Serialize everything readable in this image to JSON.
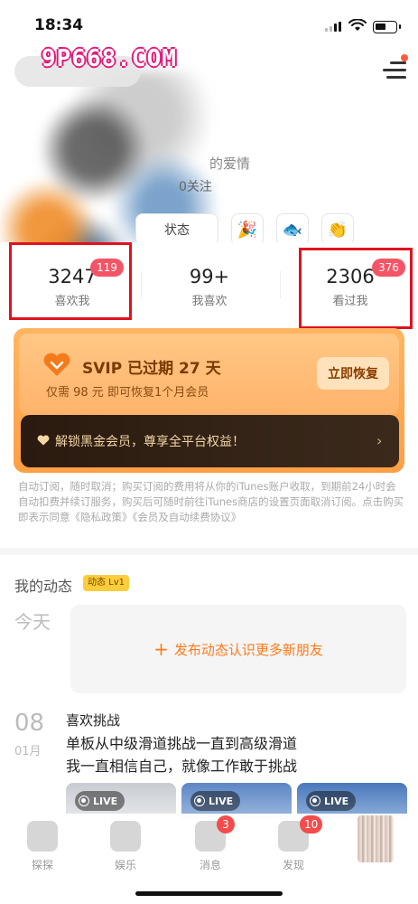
{
  "status_bar": {
    "time": "18:34"
  },
  "header": {
    "watermark": "9P668.COM",
    "signature": "的爱情",
    "follow_text": "0关注",
    "status_chip": "状态",
    "emoji_chips": [
      "🎉",
      "🐟",
      "👏"
    ]
  },
  "stats": [
    {
      "value": "3247",
      "label": "喜欢我",
      "badge": "119"
    },
    {
      "value": "99+",
      "label": "我喜欢",
      "badge": ""
    },
    {
      "value": "2306",
      "label": "看过我",
      "badge": "376"
    }
  ],
  "svip": {
    "title": "SVIP 已过期 27 天",
    "subtitle": "仅需 98 元 即可恢复1个月会员",
    "restore_label": "立即恢复",
    "black_gold_text": "解锁黑金会员，尊享全平台权益！",
    "chevron": "›"
  },
  "terms_text": "自动订阅，随时取消；购买订阅的费用将从你的iTunes账户收取，到期前24小时会自动扣费并续订服务，购买后可随时前往iTunes商店的设置页面取消订阅。点击购买即表示同意《隐私政策》《会员及自动续费协议》",
  "feed": {
    "title": "我的动态",
    "level_badge": "动态 Lv1",
    "today_label": "今天",
    "publish_plus": "+",
    "publish_label": "发布动态认识更多新朋友",
    "post": {
      "day": "08",
      "month": "01月",
      "title": "喜欢挑战",
      "body_line1": "单板从中级滑道挑战一直到高级滑道",
      "body_line2": "我一直相信自己，就像工作敢于挑战"
    },
    "live_label": "LIVE"
  },
  "tabbar": [
    {
      "label": "探探",
      "badge": ""
    },
    {
      "label": "娱乐",
      "badge": ""
    },
    {
      "label": "消息",
      "badge": "3"
    },
    {
      "label": "发现",
      "badge": "10"
    }
  ],
  "colors": {
    "accent_orange": "#ff9f44",
    "badge_red": "#f45566",
    "highlight_box": "#e0121e",
    "publish_orange": "#ff7a1a"
  }
}
